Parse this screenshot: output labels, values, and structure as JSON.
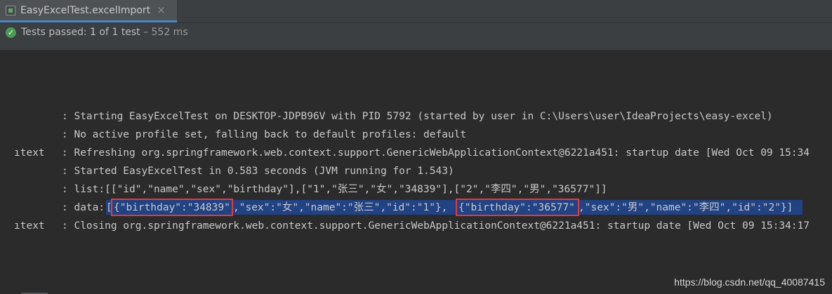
{
  "tab": {
    "title": "EasyExcelTest.excelImport",
    "close": "×"
  },
  "status": {
    "label": "Tests passed:",
    "count": "1",
    "of": "of 1 test",
    "duration": "– 552 ms"
  },
  "console": {
    "lines": [
      {
        "ctx": "",
        "msg": ": Starting EasyExcelTest on DESKTOP-JDPB96V with PID 5792 (started by user in C:\\Users\\user\\IdeaProjects\\easy-excel)"
      },
      {
        "ctx": "",
        "msg": ": No active profile set, falling back to default profiles: default"
      },
      {
        "ctx": "ıtext",
        "msg": ": Refreshing org.springframework.web.context.support.GenericWebApplicationContext@6221a451: startup date [Wed Oct 09 15:34"
      },
      {
        "ctx": "",
        "msg": ": Started EasyExcelTest in 0.583 seconds (JVM running for 1.543)"
      },
      {
        "ctx": "",
        "msg": ": list:[[\"id\",\"name\",\"sex\",\"birthday\"],[\"1\",\"张三\",\"女\",\"34839\"],[\"2\",\"李四\",\"男\",\"36577\"]]"
      }
    ],
    "data_line": {
      "prefix": ": data:",
      "seg_open": "[",
      "seg_b1": "{\"birthday\":\"34839\"",
      "seg_mid1": ",\"sex\":\"女\",\"name\":\"张三\",\"id\":\"1\"},",
      "seg_b2": "{\"birthday\":\"36577\"",
      "seg_mid2": ",\"sex\":\"男\",\"name\":\"李四\",\"id\":\"2\"}]"
    },
    "closing_line": {
      "ctx": "ıtext",
      "msg": ": Closing org.springframework.web.context.support.GenericWebApplicationContext@6221a451: startup date [Wed Oct 09 15:34:17"
    }
  },
  "watermark": "https://blog.csdn.net/qq_40087415",
  "colors": {
    "background": "#2b2b2b",
    "selection": "#214283",
    "highlight_box": "#e23b3b",
    "pass_icon": "#499c54"
  }
}
